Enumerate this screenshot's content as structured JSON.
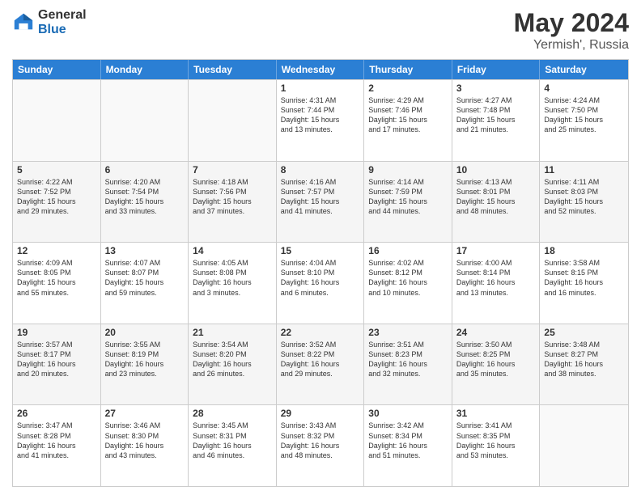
{
  "header": {
    "logo_general": "General",
    "logo_blue": "Blue",
    "title": "May 2024",
    "location": "Yermish', Russia"
  },
  "days_of_week": [
    "Sunday",
    "Monday",
    "Tuesday",
    "Wednesday",
    "Thursday",
    "Friday",
    "Saturday"
  ],
  "rows": [
    [
      {
        "day": "",
        "lines": []
      },
      {
        "day": "",
        "lines": []
      },
      {
        "day": "",
        "lines": []
      },
      {
        "day": "1",
        "lines": [
          "Sunrise: 4:31 AM",
          "Sunset: 7:44 PM",
          "Daylight: 15 hours",
          "and 13 minutes."
        ]
      },
      {
        "day": "2",
        "lines": [
          "Sunrise: 4:29 AM",
          "Sunset: 7:46 PM",
          "Daylight: 15 hours",
          "and 17 minutes."
        ]
      },
      {
        "day": "3",
        "lines": [
          "Sunrise: 4:27 AM",
          "Sunset: 7:48 PM",
          "Daylight: 15 hours",
          "and 21 minutes."
        ]
      },
      {
        "day": "4",
        "lines": [
          "Sunrise: 4:24 AM",
          "Sunset: 7:50 PM",
          "Daylight: 15 hours",
          "and 25 minutes."
        ]
      }
    ],
    [
      {
        "day": "5",
        "lines": [
          "Sunrise: 4:22 AM",
          "Sunset: 7:52 PM",
          "Daylight: 15 hours",
          "and 29 minutes."
        ]
      },
      {
        "day": "6",
        "lines": [
          "Sunrise: 4:20 AM",
          "Sunset: 7:54 PM",
          "Daylight: 15 hours",
          "and 33 minutes."
        ]
      },
      {
        "day": "7",
        "lines": [
          "Sunrise: 4:18 AM",
          "Sunset: 7:56 PM",
          "Daylight: 15 hours",
          "and 37 minutes."
        ]
      },
      {
        "day": "8",
        "lines": [
          "Sunrise: 4:16 AM",
          "Sunset: 7:57 PM",
          "Daylight: 15 hours",
          "and 41 minutes."
        ]
      },
      {
        "day": "9",
        "lines": [
          "Sunrise: 4:14 AM",
          "Sunset: 7:59 PM",
          "Daylight: 15 hours",
          "and 44 minutes."
        ]
      },
      {
        "day": "10",
        "lines": [
          "Sunrise: 4:13 AM",
          "Sunset: 8:01 PM",
          "Daylight: 15 hours",
          "and 48 minutes."
        ]
      },
      {
        "day": "11",
        "lines": [
          "Sunrise: 4:11 AM",
          "Sunset: 8:03 PM",
          "Daylight: 15 hours",
          "and 52 minutes."
        ]
      }
    ],
    [
      {
        "day": "12",
        "lines": [
          "Sunrise: 4:09 AM",
          "Sunset: 8:05 PM",
          "Daylight: 15 hours",
          "and 55 minutes."
        ]
      },
      {
        "day": "13",
        "lines": [
          "Sunrise: 4:07 AM",
          "Sunset: 8:07 PM",
          "Daylight: 15 hours",
          "and 59 minutes."
        ]
      },
      {
        "day": "14",
        "lines": [
          "Sunrise: 4:05 AM",
          "Sunset: 8:08 PM",
          "Daylight: 16 hours",
          "and 3 minutes."
        ]
      },
      {
        "day": "15",
        "lines": [
          "Sunrise: 4:04 AM",
          "Sunset: 8:10 PM",
          "Daylight: 16 hours",
          "and 6 minutes."
        ]
      },
      {
        "day": "16",
        "lines": [
          "Sunrise: 4:02 AM",
          "Sunset: 8:12 PM",
          "Daylight: 16 hours",
          "and 10 minutes."
        ]
      },
      {
        "day": "17",
        "lines": [
          "Sunrise: 4:00 AM",
          "Sunset: 8:14 PM",
          "Daylight: 16 hours",
          "and 13 minutes."
        ]
      },
      {
        "day": "18",
        "lines": [
          "Sunrise: 3:58 AM",
          "Sunset: 8:15 PM",
          "Daylight: 16 hours",
          "and 16 minutes."
        ]
      }
    ],
    [
      {
        "day": "19",
        "lines": [
          "Sunrise: 3:57 AM",
          "Sunset: 8:17 PM",
          "Daylight: 16 hours",
          "and 20 minutes."
        ]
      },
      {
        "day": "20",
        "lines": [
          "Sunrise: 3:55 AM",
          "Sunset: 8:19 PM",
          "Daylight: 16 hours",
          "and 23 minutes."
        ]
      },
      {
        "day": "21",
        "lines": [
          "Sunrise: 3:54 AM",
          "Sunset: 8:20 PM",
          "Daylight: 16 hours",
          "and 26 minutes."
        ]
      },
      {
        "day": "22",
        "lines": [
          "Sunrise: 3:52 AM",
          "Sunset: 8:22 PM",
          "Daylight: 16 hours",
          "and 29 minutes."
        ]
      },
      {
        "day": "23",
        "lines": [
          "Sunrise: 3:51 AM",
          "Sunset: 8:23 PM",
          "Daylight: 16 hours",
          "and 32 minutes."
        ]
      },
      {
        "day": "24",
        "lines": [
          "Sunrise: 3:50 AM",
          "Sunset: 8:25 PM",
          "Daylight: 16 hours",
          "and 35 minutes."
        ]
      },
      {
        "day": "25",
        "lines": [
          "Sunrise: 3:48 AM",
          "Sunset: 8:27 PM",
          "Daylight: 16 hours",
          "and 38 minutes."
        ]
      }
    ],
    [
      {
        "day": "26",
        "lines": [
          "Sunrise: 3:47 AM",
          "Sunset: 8:28 PM",
          "Daylight: 16 hours",
          "and 41 minutes."
        ]
      },
      {
        "day": "27",
        "lines": [
          "Sunrise: 3:46 AM",
          "Sunset: 8:30 PM",
          "Daylight: 16 hours",
          "and 43 minutes."
        ]
      },
      {
        "day": "28",
        "lines": [
          "Sunrise: 3:45 AM",
          "Sunset: 8:31 PM",
          "Daylight: 16 hours",
          "and 46 minutes."
        ]
      },
      {
        "day": "29",
        "lines": [
          "Sunrise: 3:43 AM",
          "Sunset: 8:32 PM",
          "Daylight: 16 hours",
          "and 48 minutes."
        ]
      },
      {
        "day": "30",
        "lines": [
          "Sunrise: 3:42 AM",
          "Sunset: 8:34 PM",
          "Daylight: 16 hours",
          "and 51 minutes."
        ]
      },
      {
        "day": "31",
        "lines": [
          "Sunrise: 3:41 AM",
          "Sunset: 8:35 PM",
          "Daylight: 16 hours",
          "and 53 minutes."
        ]
      },
      {
        "day": "",
        "lines": []
      }
    ]
  ]
}
